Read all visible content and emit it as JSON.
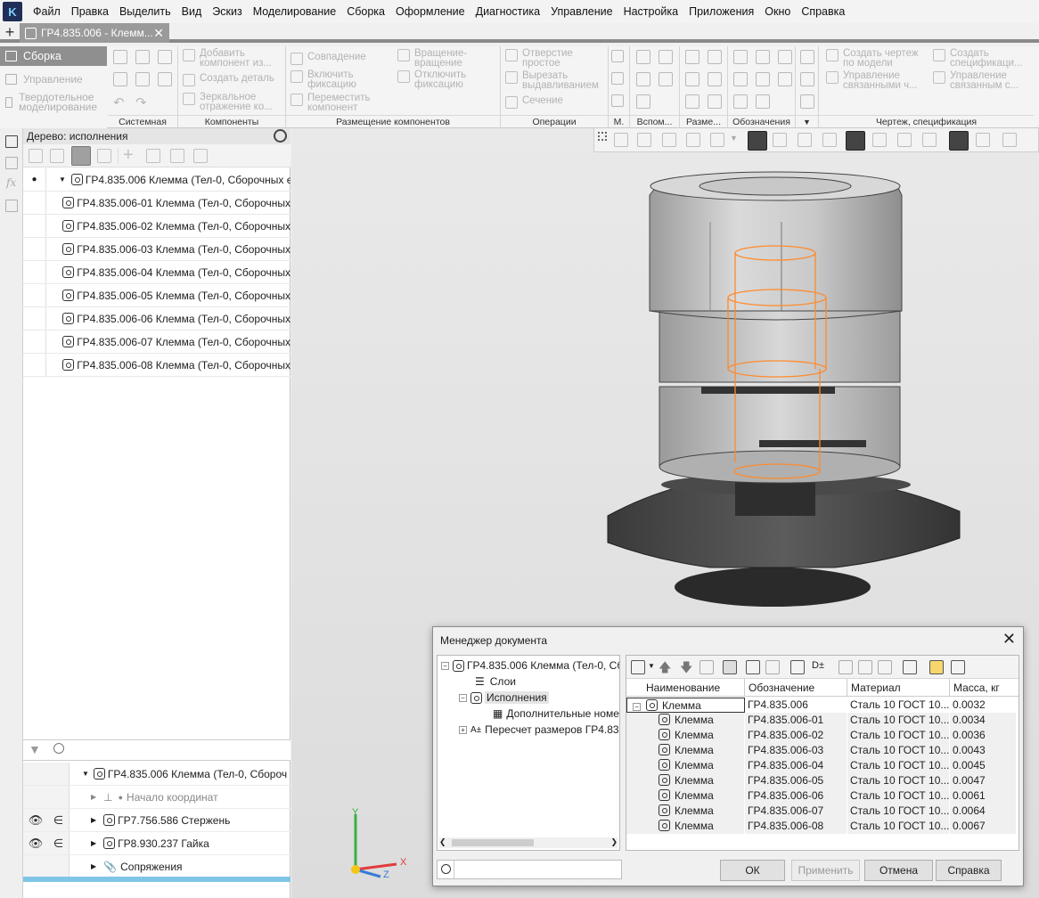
{
  "menu": [
    "Файл",
    "Правка",
    "Выделить",
    "Вид",
    "Эскиз",
    "Моделирование",
    "Сборка",
    "Оформление",
    "Диагностика",
    "Управление",
    "Настройка",
    "Приложения",
    "Окно",
    "Справка"
  ],
  "tab": {
    "title": "ГР4.835.006 - Клемм...",
    "close": "✕",
    "new": "+"
  },
  "ribbon": {
    "modes": [
      "Сборка",
      "Управление",
      "Твердотельное моделирование"
    ],
    "groups": [
      "Системная",
      "Компоненты",
      "Размещение компонентов",
      "Операции",
      "М.",
      "Вспом...",
      "Разме...",
      "Обозначения",
      "Чертеж, спецификация"
    ],
    "components": [
      "Добавить компонент из...",
      "Создать деталь",
      "Зеркальное отражение ко..."
    ],
    "placement": [
      "Совпадение",
      "Включить фиксацию",
      "Переместить компонент",
      "Вращение-вращение",
      "Отключить фиксацию"
    ],
    "operations": [
      "Отверстие простое",
      "Вырезать выдавливанием",
      "Сечение"
    ],
    "drawing": [
      "Создать чертеж по модели",
      "Управление связанными ч...",
      "Создать спецификаци...",
      "Управление связанным с..."
    ]
  },
  "tree": {
    "title": "Дерево: исполнения",
    "root": "ГР4.835.006 Клемма (Тел-0, Сборочных ед",
    "items": [
      "ГР4.835.006-01 Клемма (Тел-0, Сборочных",
      "ГР4.835.006-02 Клемма (Тел-0, Сборочных",
      "ГР4.835.006-03 Клемма (Тел-0, Сборочных",
      "ГР4.835.006-04 Клемма (Тел-0, Сборочных",
      "ГР4.835.006-05 Клемма (Тел-0, Сборочных",
      "ГР4.835.006-06 Клемма (Тел-0, Сборочных",
      "ГР4.835.006-07 Клемма (Тел-0, Сборочных",
      "ГР4.835.006-08 Клемма (Тел-0, Сборочных"
    ]
  },
  "bottom_tree": {
    "root": "ГР4.835.006 Клемма (Тел-0, Сбороч",
    "origin": "Начало координат",
    "parts": [
      "ГР7.756.586 Стержень",
      "ГР8.930.237 Гайка"
    ],
    "mates": "Сопряжения"
  },
  "axes": {
    "x": "X",
    "y": "Y",
    "z": "Z"
  },
  "dialog": {
    "title": "Менеджер документа",
    "close": "✕",
    "tree": [
      "ГР4.835.006 Клемма (Тел-0, Сб",
      "Слои",
      "Исполнения",
      "Дополнительные номе",
      "Пересчет размеров ГР4.83"
    ],
    "toolbar_label": "D±",
    "columns": [
      "Наименование",
      "Обозначение",
      "Материал",
      "Масса, кг"
    ],
    "rows": [
      {
        "name": "Клемма",
        "code": "ГР4.835.006",
        "material": "Сталь 10  ГОСТ 10...",
        "mass": "0.0032"
      },
      {
        "name": "Клемма",
        "code": "ГР4.835.006-01",
        "material": "Сталь 10  ГОСТ 10...",
        "mass": "0.0034"
      },
      {
        "name": "Клемма",
        "code": "ГР4.835.006-02",
        "material": "Сталь 10  ГОСТ 10...",
        "mass": "0.0036"
      },
      {
        "name": "Клемма",
        "code": "ГР4.835.006-03",
        "material": "Сталь 10  ГОСТ 10...",
        "mass": "0.0043"
      },
      {
        "name": "Клемма",
        "code": "ГР4.835.006-04",
        "material": "Сталь 10  ГОСТ 10...",
        "mass": "0.0045"
      },
      {
        "name": "Клемма",
        "code": "ГР4.835.006-05",
        "material": "Сталь 10  ГОСТ 10...",
        "mass": "0.0047"
      },
      {
        "name": "Клемма",
        "code": "ГР4.835.006-06",
        "material": "Сталь 10  ГОСТ 10...",
        "mass": "0.0061"
      },
      {
        "name": "Клемма",
        "code": "ГР4.835.006-07",
        "material": "Сталь 10  ГОСТ 10...",
        "mass": "0.0064"
      },
      {
        "name": "Клемма",
        "code": "ГР4.835.006-08",
        "material": "Сталь 10  ГОСТ 10...",
        "mass": "0.0067"
      }
    ],
    "buttons": {
      "ok": "ОК",
      "apply": "Применить",
      "cancel": "Отмена",
      "help": "Справка"
    }
  },
  "colors": {
    "accent_orange": "#ff8a2b",
    "selection": "#cce8ff"
  }
}
